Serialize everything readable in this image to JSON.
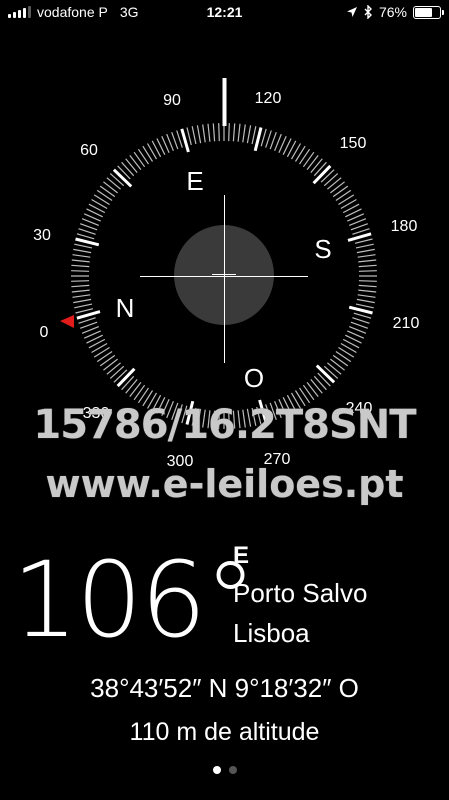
{
  "status_bar": {
    "carrier": "vodafone P",
    "network": "3G",
    "time": "12:21",
    "battery": "76%",
    "battery_level": 0.76,
    "icons": [
      "signal-bars-icon",
      "location-arrow-icon",
      "bluetooth-icon",
      "battery-icon"
    ]
  },
  "compass": {
    "cardinals": {
      "north": "N",
      "east": "E",
      "south": "S",
      "west": "O"
    },
    "degree_labels": [
      "0",
      "30",
      "60",
      "90",
      "120",
      "150",
      "180",
      "210",
      "240",
      "270",
      "300",
      "330"
    ],
    "heading_degrees": 106,
    "colors": {
      "background": "#000000",
      "ticks": "#ffffff",
      "target_marker": "#e21b1b"
    }
  },
  "watermark": {
    "line1": "15786/16.2T8SNT",
    "line2": "www.e-leiloes.pt"
  },
  "readout": {
    "heading": "106°",
    "direction": "E",
    "locality": "Porto Salvo",
    "region": "Lisboa",
    "coordinates": "38°43′52″ N  9°18′32″ O",
    "altitude": "110 m de altitude"
  },
  "page_indicator": {
    "pages": 2,
    "current": 1
  }
}
